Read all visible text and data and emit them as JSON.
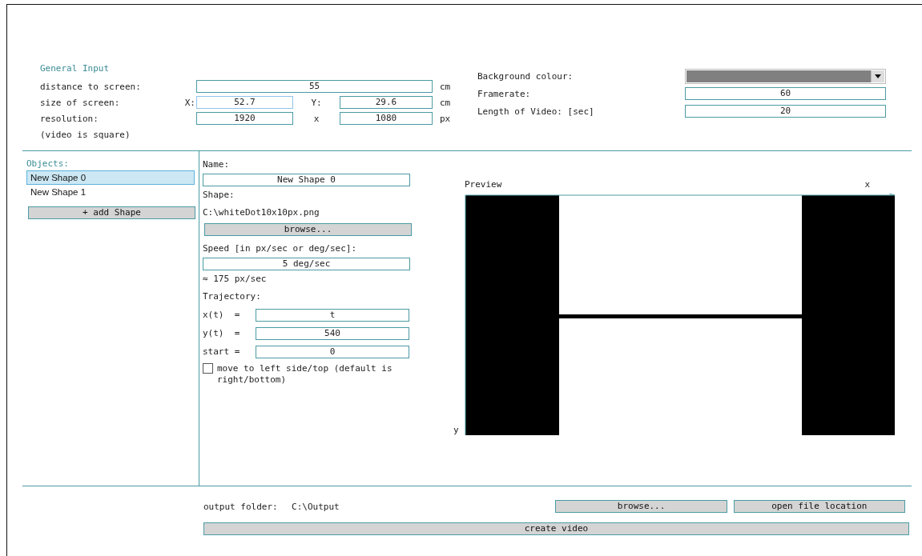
{
  "general_input": {
    "title": "General Input",
    "distance": {
      "label": "distance to screen:",
      "value": "55",
      "unit": "cm"
    },
    "size": {
      "label": "size of screen:",
      "x_label": "X:",
      "x_value": "52.7",
      "x_focused": true,
      "y_label": "Y:",
      "y_value": "29.6",
      "unit": "cm"
    },
    "resolution": {
      "label": "resolution:",
      "note": "(video is square)",
      "x_value": "1920",
      "separator": "x",
      "y_value": "1080",
      "unit": "px"
    },
    "background": {
      "label": "Background colour:",
      "color": "#808080"
    },
    "framerate": {
      "label": "Framerate:",
      "value": "60"
    },
    "length": {
      "label": "Length of Video: [sec]",
      "value": "20"
    }
  },
  "objects": {
    "title": "Objects:",
    "items": [
      {
        "label": "New Shape 0",
        "selected": true
      },
      {
        "label": "New Shape 1",
        "selected": false
      }
    ],
    "add_button": "+ add Shape"
  },
  "shape_editor": {
    "name_label": "Name:",
    "name_value": "New Shape 0",
    "shape_label": "Shape:",
    "shape_path": "C:\\whiteDot10x10px.png",
    "browse_button": "browse...",
    "speed_label": "Speed [in px/sec or deg/sec]:",
    "speed_value": "5 deg/sec",
    "speed_converted": "≈ 175 px/sec",
    "trajectory_label": "Trajectory:",
    "trajectory": [
      {
        "label": "x(t)  =",
        "value": "t"
      },
      {
        "label": "y(t)  =",
        "value": "540"
      },
      {
        "label": "start =",
        "value": "0"
      }
    ],
    "reverse": {
      "label": "move to left side/top (default is right/bottom)",
      "checked": false
    }
  },
  "preview": {
    "title": "Preview",
    "x_axis_label": "x",
    "y_axis_label": "y"
  },
  "output": {
    "label": "output folder:",
    "path": "C:\\Output",
    "browse_button": "browse...",
    "open_button": "open file location",
    "create_button": "create video"
  }
}
